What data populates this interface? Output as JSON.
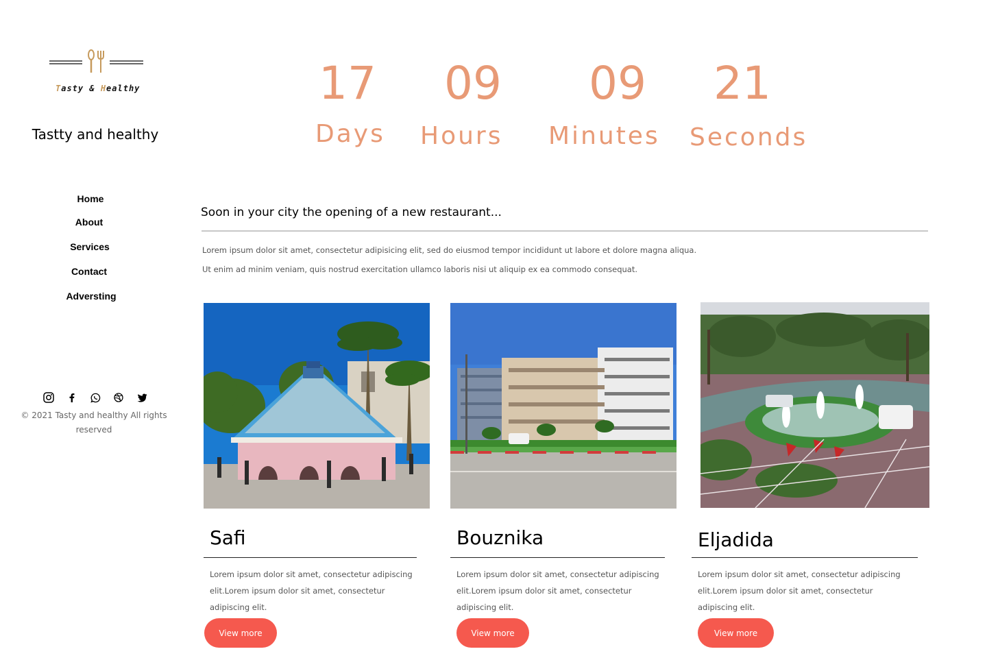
{
  "logo": {
    "text_part1": "T",
    "text_part2": "asty & ",
    "text_part3": "H",
    "text_part4": "ealthy"
  },
  "brand": {
    "title": "Tastty and healthy"
  },
  "nav": {
    "items": [
      "Home",
      "About",
      "Services",
      "Contact",
      "Adversting"
    ]
  },
  "social": {
    "icons": [
      "instagram-icon",
      "facebook-icon",
      "whatsapp-icon",
      "dribbble-icon",
      "twitter-icon"
    ]
  },
  "footer": {
    "copyright_line1": "© 2021 Tasty and healthy All rights",
    "copyright_line2": "reserved"
  },
  "countdown": {
    "days": {
      "value": "17",
      "label": "Days"
    },
    "hours": {
      "value": "09",
      "label": "Hours"
    },
    "minutes": {
      "value": "09",
      "label": "Minutes"
    },
    "seconds": {
      "value": "21",
      "label": "Seconds"
    }
  },
  "intro": {
    "headline": "Soon in your city the opening of a new restaurant...",
    "line1": "Lorem ipsum dolor sit amet, consectetur adipisicing elit, sed do eiusmod tempor incididunt ut labore et dolore magna aliqua.",
    "line2": "Ut enim ad minim veniam, quis nostrud exercitation ullamco laboris nisi ut aliquip ex ea commodo consequat."
  },
  "cards": [
    {
      "title": "Safi",
      "text": "Lorem ipsum dolor sit amet, consectetur adipiscing elit.Lorem ipsum dolor sit amet, consectetur adipiscing elit.",
      "button": "View more"
    },
    {
      "title": "Bouznika",
      "text": "Lorem ipsum dolor sit amet, consectetur adipiscing elit.Lorem ipsum dolor sit amet, consectetur adipiscing elit.",
      "button": "View more"
    },
    {
      "title": "Eljadida",
      "text": "Lorem ipsum dolor sit amet, consectetur adipiscing elit.Lorem ipsum dolor sit amet, consectetur adipiscing elit.",
      "button": "View more"
    }
  ],
  "colors": {
    "accent": "#e89a76",
    "button": "#f5594e",
    "logo_gold": "#c69a5c"
  }
}
